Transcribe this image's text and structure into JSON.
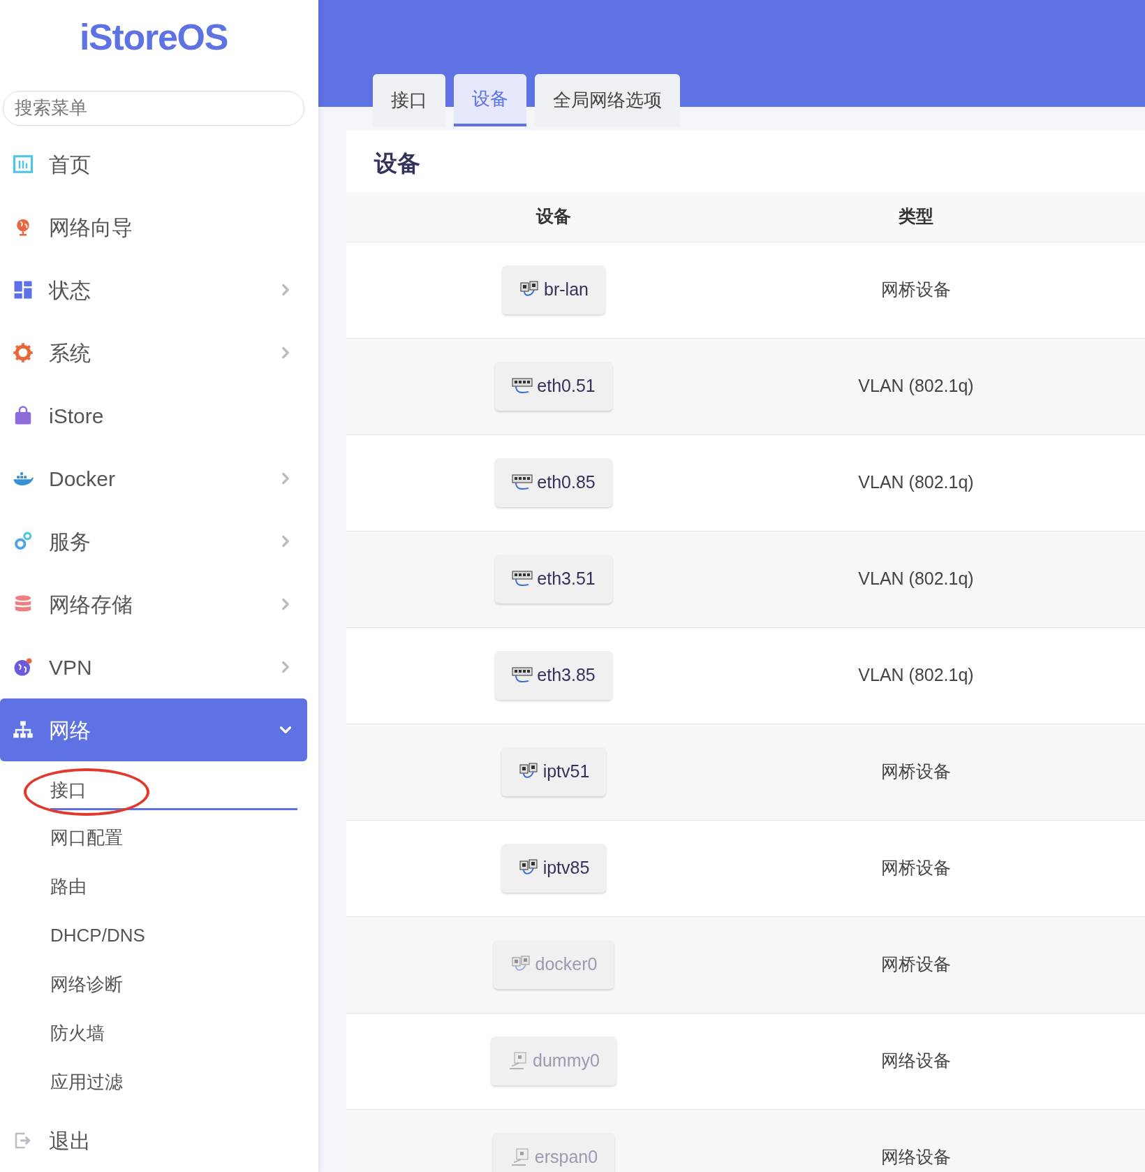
{
  "logo": "iStoreOS",
  "search": {
    "placeholder": "搜索菜单"
  },
  "sidebar": {
    "items": [
      {
        "label": "首页",
        "kind": "chart",
        "has_submenu": false,
        "selected": false
      },
      {
        "label": "网络向导",
        "kind": "globe",
        "has_submenu": false,
        "selected": false
      },
      {
        "label": "状态",
        "kind": "dashboard",
        "has_submenu": true,
        "selected": false
      },
      {
        "label": "系统",
        "kind": "gear",
        "has_submenu": true,
        "selected": false
      },
      {
        "label": "iStore",
        "kind": "bag",
        "has_submenu": false,
        "selected": false
      },
      {
        "label": "Docker",
        "kind": "whale",
        "has_submenu": true,
        "selected": false
      },
      {
        "label": "服务",
        "kind": "gears",
        "has_submenu": true,
        "selected": false
      },
      {
        "label": "网络存储",
        "kind": "database",
        "has_submenu": true,
        "selected": false
      },
      {
        "label": "VPN",
        "kind": "vpn",
        "has_submenu": true,
        "selected": false
      },
      {
        "label": "网络",
        "kind": "network",
        "has_submenu": true,
        "selected": true,
        "expanded": true,
        "children": [
          {
            "label": "接口",
            "selected": true,
            "circled": true
          },
          {
            "label": "网口配置",
            "selected": false,
            "circled": false
          },
          {
            "label": "路由",
            "selected": false,
            "circled": false
          },
          {
            "label": "DHCP/DNS",
            "selected": false,
            "circled": false
          },
          {
            "label": "网络诊断",
            "selected": false,
            "circled": false
          },
          {
            "label": "防火墙",
            "selected": false,
            "circled": false
          },
          {
            "label": "应用过滤",
            "selected": false,
            "circled": false
          }
        ]
      },
      {
        "label": "退出",
        "kind": "logout",
        "has_submenu": false,
        "selected": false
      }
    ]
  },
  "tabs": [
    {
      "label": "接口",
      "selected": false
    },
    {
      "label": "设备",
      "selected": true
    },
    {
      "label": "全局网络选项",
      "selected": false
    }
  ],
  "card": {
    "title": "设备",
    "table": {
      "columns": [
        "设备",
        "类型"
      ],
      "rows": [
        {
          "device": "br-lan",
          "kind": "bridge",
          "active": true,
          "type": "网桥设备"
        },
        {
          "device": "eth0.51",
          "kind": "vlan",
          "active": true,
          "type": "VLAN (802.1q)"
        },
        {
          "device": "eth0.85",
          "kind": "vlan",
          "active": true,
          "type": "VLAN (802.1q)"
        },
        {
          "device": "eth3.51",
          "kind": "vlan",
          "active": true,
          "type": "VLAN (802.1q)"
        },
        {
          "device": "eth3.85",
          "kind": "vlan",
          "active": true,
          "type": "VLAN (802.1q)"
        },
        {
          "device": "iptv51",
          "kind": "bridge",
          "active": true,
          "type": "网桥设备"
        },
        {
          "device": "iptv85",
          "kind": "bridge",
          "active": true,
          "type": "网桥设备"
        },
        {
          "device": "docker0",
          "kind": "bridge",
          "active": false,
          "type": "网桥设备"
        },
        {
          "device": "dummy0",
          "kind": "ethernet",
          "active": false,
          "type": "网络设备"
        },
        {
          "device": "erspan0",
          "kind": "ethernet",
          "active": false,
          "type": "网络设备"
        }
      ]
    }
  }
}
